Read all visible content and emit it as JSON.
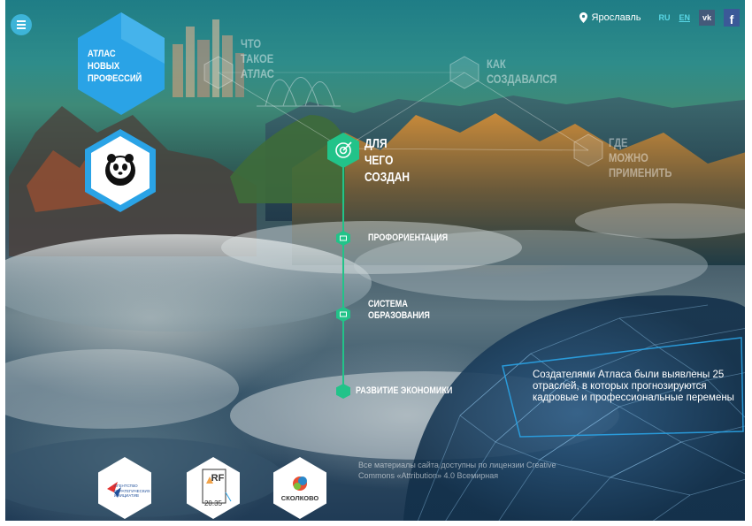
{
  "header": {
    "menu_icon": "menu-icon",
    "city": "Ярославль",
    "lang_ru": "RU",
    "lang_en": "EN",
    "vk": "vk",
    "facebook": "f"
  },
  "logo": {
    "line1": "АТЛАС",
    "line2": "НОВЫХ",
    "line3": "ПРОФЕССИЙ"
  },
  "nav": {
    "also_atlas": [
      "ЧТО",
      "ТАКОЕ",
      "АТЛАС"
    ],
    "how_created": [
      "КАК",
      "СОЗДАВАЛСЯ"
    ],
    "why_created": [
      "ДЛЯ",
      "ЧЕГО",
      "СОЗДАН"
    ],
    "where_apply": [
      "ГДЕ",
      "МОЖНО",
      "ПРИМЕНИТЬ"
    ]
  },
  "sub_items": [
    {
      "label": "ПРОФОРИЕНТАЦИЯ"
    },
    {
      "label": "СИСТЕМА ОБРАЗОВАНИЯ"
    },
    {
      "label": "РАЗВИТИЕ ЭКОНОМИКИ"
    }
  ],
  "info_text": "Создателями Атласа были выявлены 25 отраслей, в которых прогнозируются кадровые и профессиональные перемены",
  "footer_note": "Все материалы сайта доступны по лицензии Creative Commons «Attribution» 4.0 Всемирная",
  "partners": {
    "asi_line1": "АГЕНТСТВО",
    "asi_line2": "СТРАТЕГИЧЕСКИХ",
    "asi_line3": "ИНИЦИАТИВ",
    "rf": "RF",
    "rf_year": "20.35",
    "skolkovo": "СКОЛКОВО"
  },
  "colors": {
    "accent_blue": "#2aa3e6",
    "accent_green": "#22c389",
    "link_cyan": "#59d7e6"
  }
}
